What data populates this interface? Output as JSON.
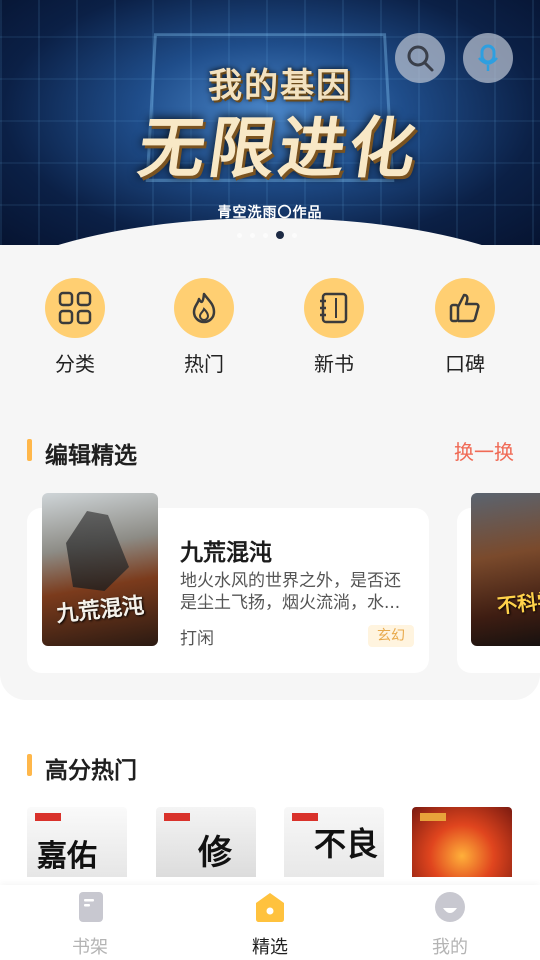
{
  "banner": {
    "sub_title": "我的基因",
    "main_title": "无限进化",
    "author_credit": "青空洗雨〇作品",
    "dots_count": 5,
    "active_dot": 3
  },
  "quick_nav": [
    {
      "label": "分类",
      "icon": "grid-icon"
    },
    {
      "label": "热门",
      "icon": "flame-icon"
    },
    {
      "label": "新书",
      "icon": "notebook-icon"
    },
    {
      "label": "口碑",
      "icon": "thumbs-up-icon"
    }
  ],
  "editor_picks": {
    "title": "编辑精选",
    "refresh_label": "换一换",
    "book": {
      "title": "九荒混沌",
      "cover_text": "九荒混沌",
      "description": "地火水风的世界之外，是否还是尘土飞扬，烟火流淌，水...",
      "author": "打闲",
      "tag": "玄幻"
    },
    "peek_cover_text": "不科学"
  },
  "high_score": {
    "title": "高分热门",
    "covers": [
      "嘉佑",
      "修",
      "不良",
      ""
    ]
  },
  "tabbar": [
    {
      "label": "书架",
      "icon": "bookshelf-icon",
      "active": false
    },
    {
      "label": "精选",
      "icon": "featured-home-icon",
      "active": true
    },
    {
      "label": "我的",
      "icon": "profile-icon",
      "active": false
    }
  ],
  "colors": {
    "accent": "#ffcf72",
    "section_bar": "#ffb74a",
    "refresh": "#f06a55",
    "tag_text": "#e8a94a"
  }
}
